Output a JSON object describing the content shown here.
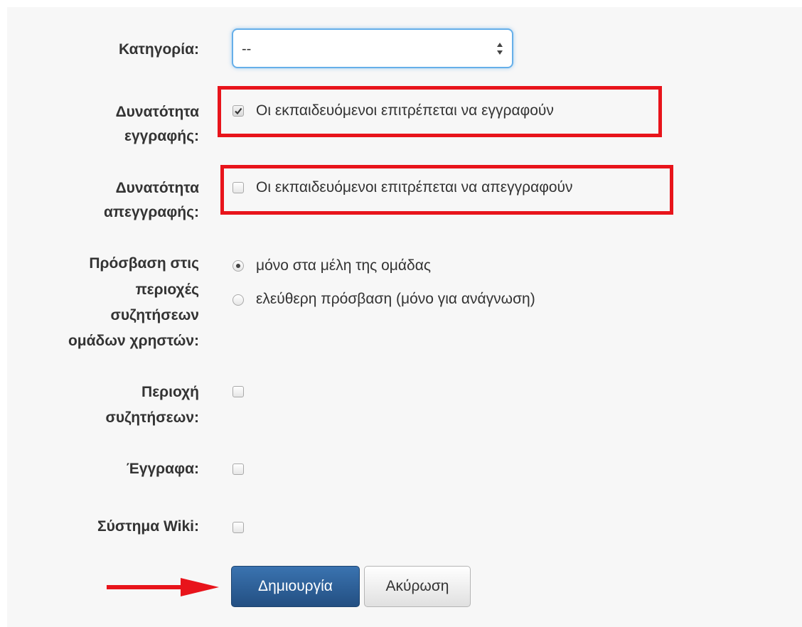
{
  "form": {
    "category": {
      "label": "Κατηγορία:",
      "selected": "--",
      "icon": "select-arrows-icon"
    },
    "registration": {
      "label_line1": "Δυνατότητα",
      "label_line2": "εγγραφής:",
      "option_text": "Οι εκπαιδευόμενοι επιτρέπεται να εγγραφούν",
      "checked": true
    },
    "unregistration": {
      "label_line1": "Δυνατότητα",
      "label_line2": "απεγγραφής:",
      "option_text": "Οι εκπαιδευόμενοι επιτρέπεται να απεγγραφούν",
      "checked": false
    },
    "forum_access": {
      "label_line1": "Πρόσβαση στις",
      "label_line2": "περιοχές",
      "label_line3": "συζητήσεων",
      "label_line4": "ομάδων χρηστών:",
      "options": [
        {
          "text": "μόνο στα μέλη της ομάδας",
          "selected": true
        },
        {
          "text": "ελεύθερη πρόσβαση (μόνο για ανάγνωση)",
          "selected": false
        }
      ]
    },
    "forum": {
      "label_line1": "Περιοχή",
      "label_line2": "συζητήσεων:",
      "checked": false
    },
    "documents": {
      "label": "Έγγραφα:",
      "checked": false
    },
    "wiki": {
      "label": "Σύστημα Wiki:",
      "checked": false
    },
    "buttons": {
      "create_label": "Δημιουργία",
      "cancel_label": "Ακύρωση"
    }
  },
  "annotations": {
    "highlight_color": "#e8141b",
    "arrow_icon": "red-arrow-icon"
  },
  "colors": {
    "primary_button": "#2b5c94",
    "focus_border": "#66afe9",
    "panel_background": "#f7f7f7"
  }
}
